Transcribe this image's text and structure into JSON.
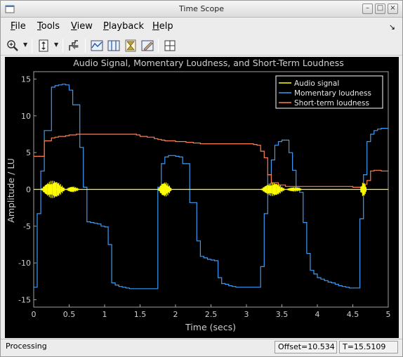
{
  "window": {
    "title": "Time Scope"
  },
  "menubar": {
    "items": [
      {
        "label": "File",
        "underline": "F",
        "rest": "ile"
      },
      {
        "label": "Tools",
        "underline": "T",
        "rest": "ools"
      },
      {
        "label": "View",
        "underline": "V",
        "rest": "iew"
      },
      {
        "label": "Playback",
        "underline": "P",
        "rest": "layback"
      },
      {
        "label": "Help",
        "underline": "H",
        "rest": "elp"
      }
    ],
    "undock_glyph": "↘"
  },
  "toolbar": {
    "icons": [
      "zoom-in-icon",
      "scale-axes-icon",
      "signal-selection-icon",
      "triggers-icon",
      "cursor-measurements-icon",
      "peak-finder-icon",
      "bilevel-measurements-icon",
      "layout-icon"
    ]
  },
  "status": {
    "text": "Processing",
    "offset": "Offset=10.534",
    "time": "T=15.5109"
  },
  "chart_data": {
    "type": "line",
    "title": "Audio Signal, Momentary Loudness, and Short-Term Loudness",
    "xlabel": "Time (secs)",
    "ylabel": "Amplitude / LU",
    "xlim": [
      0,
      5
    ],
    "ylim": [
      -16,
      16
    ],
    "xticks": [
      0,
      0.5,
      1,
      1.5,
      2,
      2.5,
      3,
      3.5,
      4,
      4.5,
      5
    ],
    "xtick_labels": [
      "0",
      "0.5",
      "1",
      "1.5",
      "2",
      "2.5",
      "3",
      "3.5",
      "4",
      "4.5",
      "5"
    ],
    "yticks": [
      -15,
      -10,
      -5,
      0,
      5,
      10,
      15
    ],
    "ytick_labels": [
      "-15",
      "-10",
      "-5",
      "0",
      "5",
      "10",
      "15"
    ],
    "grid": true,
    "legend_position": "top-right",
    "background": "#000000",
    "axis_color": "#a0a0a0",
    "series": [
      {
        "name": "Audio signal",
        "color": "#ffff00",
        "style": "bursts",
        "bursts": [
          [
            0.1,
            0.45,
            1.2
          ],
          [
            0.45,
            0.65,
            0.4
          ],
          [
            1.75,
            1.95,
            1.0
          ],
          [
            3.2,
            3.55,
            0.9
          ],
          [
            3.55,
            3.8,
            0.3
          ],
          [
            4.6,
            4.7,
            1.0
          ]
        ]
      },
      {
        "name": "Momentary loudness",
        "color": "#3d9bf5",
        "style": "steps",
        "x": [
          0,
          0.05,
          0.1,
          0.15,
          0.25,
          0.3,
          0.35,
          0.4,
          0.45,
          0.5,
          0.55,
          0.65,
          0.7,
          0.75,
          0.8,
          0.85,
          0.9,
          0.95,
          1.0,
          1.05,
          1.1,
          1.15,
          1.2,
          1.25,
          1.3,
          1.35,
          1.4,
          1.45,
          1.5,
          1.55,
          1.6,
          1.65,
          1.7,
          1.75,
          1.8,
          1.85,
          1.9,
          1.95,
          2.0,
          2.05,
          2.1,
          2.2,
          2.3,
          2.35,
          2.4,
          2.45,
          2.5,
          2.55,
          2.6,
          2.65,
          2.7,
          2.75,
          2.8,
          2.85,
          2.9,
          2.95,
          3.0,
          3.05,
          3.1,
          3.15,
          3.2,
          3.25,
          3.3,
          3.35,
          3.4,
          3.45,
          3.5,
          3.55,
          3.6,
          3.65,
          3.7,
          3.75,
          3.8,
          3.85,
          3.9,
          3.95,
          4.0,
          4.05,
          4.1,
          4.15,
          4.2,
          4.25,
          4.3,
          4.35,
          4.4,
          4.45,
          4.5,
          4.55,
          4.6,
          4.65,
          4.7,
          4.75,
          4.8,
          4.85,
          4.9,
          4.95,
          5.0
        ],
        "y": [
          -13.3,
          -3.3,
          2.5,
          8.0,
          13.9,
          14.1,
          14.2,
          14.3,
          14.2,
          13.5,
          11.5,
          5.7,
          0.3,
          -4.4,
          -4.5,
          -4.6,
          -4.7,
          -5.0,
          -5.1,
          -7.5,
          -12.7,
          -13.0,
          -13.2,
          -13.3,
          -13.4,
          -13.5,
          -13.5,
          -13.5,
          -13.5,
          -13.5,
          -13.5,
          -13.5,
          -13.5,
          0.3,
          3.5,
          4.4,
          4.6,
          4.6,
          4.5,
          4.4,
          3.5,
          -1.8,
          -7.0,
          -9.1,
          -9.3,
          -9.5,
          -9.6,
          -9.7,
          -12.0,
          -12.8,
          -12.9,
          -13.1,
          -13.2,
          -13.3,
          -13.3,
          -13.3,
          -13.3,
          -13.3,
          -13.3,
          -13.3,
          -10.5,
          -3.3,
          2.0,
          4.0,
          6.0,
          6.5,
          6.7,
          6.7,
          5.0,
          2.6,
          0.2,
          -0.4,
          -4.5,
          -8.7,
          -11.0,
          -11.5,
          -12.0,
          -12.2,
          -12.4,
          -12.6,
          -12.7,
          -12.9,
          -13.1,
          -13.2,
          -13.3,
          -13.4,
          -13.4,
          -13.4,
          -4.0,
          2.0,
          6.5,
          7.5,
          8.0,
          8.2,
          8.3,
          8.3,
          8.3
        ]
      },
      {
        "name": "Short-term loudness",
        "color": "#ff7f50",
        "style": "steps",
        "x": [
          0,
          0.05,
          0.1,
          0.15,
          0.25,
          0.3,
          0.35,
          0.45,
          0.5,
          0.6,
          0.65,
          0.7,
          1.35,
          1.45,
          1.5,
          1.6,
          1.7,
          1.75,
          1.8,
          1.85,
          1.95,
          2.0,
          2.05,
          2.15,
          2.25,
          2.35,
          2.45,
          2.6,
          2.85,
          3.0,
          3.05,
          3.1,
          3.15,
          3.2,
          3.25,
          3.3,
          3.35,
          3.45,
          3.55,
          4.5,
          4.55,
          4.6,
          4.65,
          4.7,
          4.75,
          4.8,
          4.85,
          4.9,
          4.95,
          5.0
        ],
        "y": [
          4.5,
          4.5,
          4.5,
          6.6,
          7.0,
          7.1,
          7.2,
          7.3,
          7.4,
          7.5,
          7.5,
          7.5,
          7.5,
          7.4,
          7.2,
          7.1,
          6.9,
          6.8,
          6.7,
          6.6,
          6.6,
          6.5,
          6.5,
          6.4,
          6.3,
          6.2,
          6.2,
          6.2,
          6.2,
          6.2,
          6.2,
          6.1,
          6.0,
          5.2,
          4.3,
          2.0,
          0.9,
          0.6,
          0.4,
          0.3,
          0.3,
          0.3,
          0.7,
          1.2,
          2.5,
          2.6,
          2.6,
          2.5,
          2.5,
          2.5
        ]
      }
    ]
  }
}
